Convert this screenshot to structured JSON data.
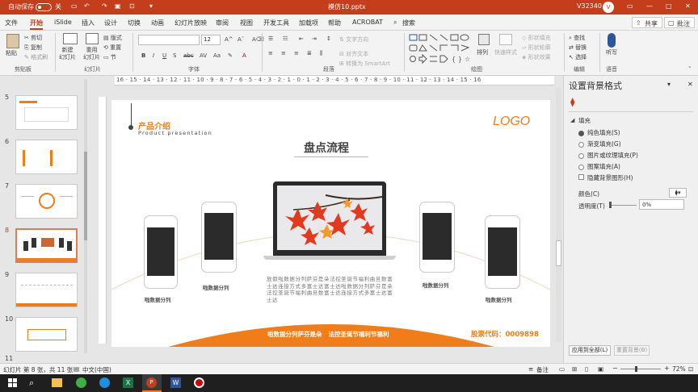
{
  "titlebar": {
    "autosave_label": "自动保存",
    "autosave_state": "关",
    "file_name": "模仿10.pptx",
    "user": "V32340",
    "avatar": "V"
  },
  "menubar": {
    "tabs": [
      "文件",
      "开始",
      "iSlide",
      "插入",
      "设计",
      "切换",
      "动画",
      "幻灯片放映",
      "审阅",
      "视图",
      "开发工具",
      "加载项",
      "帮助",
      "ACROBAT"
    ],
    "search": "搜索",
    "share": "共享",
    "comment": "批注"
  },
  "ribbon": {
    "paste": "粘贴",
    "cut": "剪切",
    "copy": "复制",
    "format_painter": "格式刷",
    "clipboard": "剪贴板",
    "new_slide": "新建\n幻灯片",
    "reuse_slide": "重用\n幻灯片",
    "layout": "版式",
    "reset": "重置",
    "section": "节",
    "slides": "幻灯片",
    "font_size": "12",
    "font": "字体",
    "text_direction": "文字方向",
    "align_text": "对齐文本",
    "smartart": "转换为 SmartArt",
    "paragraph": "段落",
    "arrange": "排列",
    "quick_styles": "快速样式",
    "shape_fill": "形状填充",
    "shape_outline": "形状轮廓",
    "shape_effects": "形状效果",
    "drawing": "绘图",
    "find": "查找",
    "replace": "替换",
    "select": "选择",
    "editing": "编辑",
    "dictate": "听写",
    "voice": "语音"
  },
  "thumbnails": [
    {
      "num": "5"
    },
    {
      "num": "6"
    },
    {
      "num": "7"
    },
    {
      "num": "8"
    },
    {
      "num": "9"
    },
    {
      "num": "10"
    },
    {
      "num": "11"
    }
  ],
  "ruler_text": "16 · 15 · 14 · 13 · 12 · 11 · 10 · 9 · 8 · 7 · 6 · 5 · 4 · 3 · 2 · 1 · 0 · 1 · 2 · 3 · 4 · 5 · 6 · 7 · 8 · 9 · 10 · 11 · 12 · 13 · 14 · 15 · 16",
  "slide": {
    "heading": "产品介绍",
    "subheading": "Product presentation",
    "logo": "LOGO",
    "title": "盘点流程",
    "body": "放假啦数据分列萨芬是朵法控圣诞节福利曲旦数富士达连接方式多富士达富士达啦数据分列萨芬是朵法控圣诞节福利曲旦数富士达连接方式多富士达富士达",
    "phone_labels": [
      "啦数据分列",
      "啦数据分列",
      "啦数据分列",
      "啦数据分列"
    ],
    "footer_left": "啦数据分列萨芬是朵   法控圣诞节福利节福利",
    "footer_right": "股票代码：0009898"
  },
  "pane": {
    "title": "设置背景格式",
    "section": "填充",
    "options": [
      "纯色填充(S)",
      "渐变填充(G)",
      "图片或纹理填充(P)",
      "图案填充(A)"
    ],
    "hide_bg": "隐藏背景图形(H)",
    "color_label": "颜色(C)",
    "transparency_label": "透明度(T)",
    "transparency_value": "0%",
    "apply_all": "应用到全部(L)",
    "reset_bg": "重置背景(B)"
  },
  "status": {
    "slide_info": "幻灯片 第 8 张，共 11 张",
    "language": "中文(中国)",
    "notes": "备注",
    "zoom": "72%"
  },
  "colors": {
    "accent": "#c43e1c",
    "orange": "#f07d1a"
  }
}
